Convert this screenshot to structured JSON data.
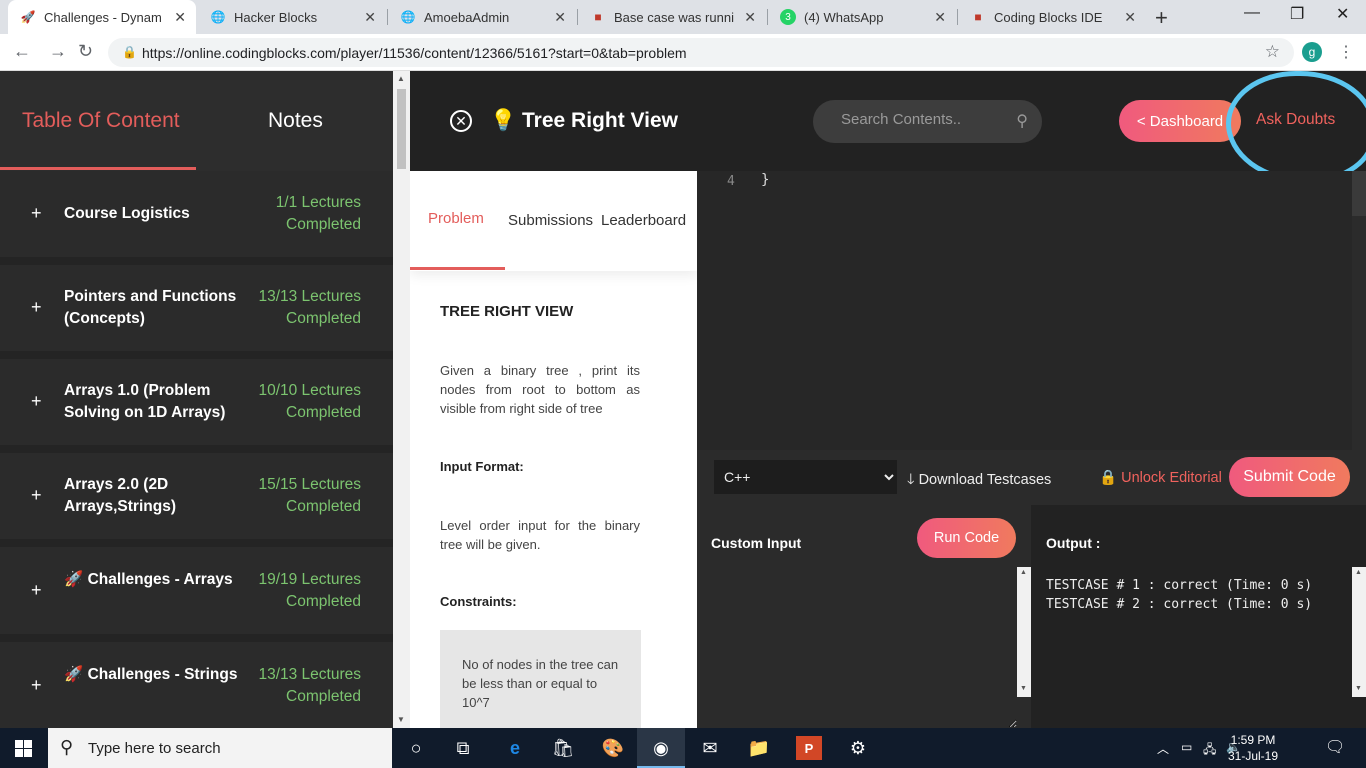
{
  "browser": {
    "tabs": [
      {
        "title": "Challenges - Dynam",
        "active": true
      },
      {
        "title": "Hacker Blocks"
      },
      {
        "title": "AmoebaAdmin"
      },
      {
        "title": "Base case was running"
      },
      {
        "title": "(4) WhatsApp"
      },
      {
        "title": "Coding Blocks IDE"
      }
    ],
    "url": "https://online.codingblocks.com/player/11536/content/12366/5161?start=0&tab=problem",
    "profile_initial": "g"
  },
  "sidebar": {
    "tab_toc": "Table Of Content",
    "tab_notes": "Notes",
    "sections": [
      {
        "name": "Course Logistics",
        "progress": "1/1 Lectures Completed"
      },
      {
        "name": "Pointers and Functions (Concepts)",
        "progress": "13/13 Lectures Completed"
      },
      {
        "name": "Arrays 1.0 (Problem Solving on 1D Arrays)",
        "progress": "10/10 Lectures Completed"
      },
      {
        "name": "Arrays 2.0 (2D Arrays,Strings)",
        "progress": "15/15 Lectures Completed"
      },
      {
        "name": "🚀 Challenges - Arrays",
        "progress": "19/19 Lectures Completed"
      },
      {
        "name": "🚀 Challenges - Strings",
        "progress": "13/13 Lectures Completed"
      }
    ]
  },
  "header": {
    "title": "Tree Right View",
    "search_placeholder": "Search Contents..",
    "dashboard_label": "< Dashboard",
    "ask_doubts_label": "Ask Doubts"
  },
  "problem": {
    "tabs": [
      "Problem",
      "Submissions",
      "Leaderboard"
    ],
    "heading": "TREE RIGHT VIEW",
    "description": "Given a binary tree , print its nodes from root to bottom as visible from right side of tree",
    "input_heading": "Input Format:",
    "input_text": "Level order input for the binary tree will be given.",
    "constraints_heading": "Constraints:",
    "constraints_text": "No of nodes in the tree can be less than or equal to 10^7"
  },
  "editor": {
    "line_number": "4",
    "code": "}",
    "language": "C++",
    "download_label": "Download Testcases",
    "unlock_label": "Unlock Editorial",
    "submit_label": "Submit Code",
    "custom_input_label": "Custom Input",
    "run_label": "Run Code",
    "output_label": "Output :",
    "output_lines": [
      "TESTCASE # 1 : correct (Time: 0 s)",
      "TESTCASE # 2 : correct (Time: 0 s)"
    ]
  },
  "taskbar": {
    "search_placeholder": "Type here to search",
    "time": "1:59 PM",
    "date": "31-Jul-19"
  },
  "colors": {
    "accent": "#e35d5b",
    "progress_green": "#7cc46f",
    "annotation_circle": "#5bc6f0"
  }
}
